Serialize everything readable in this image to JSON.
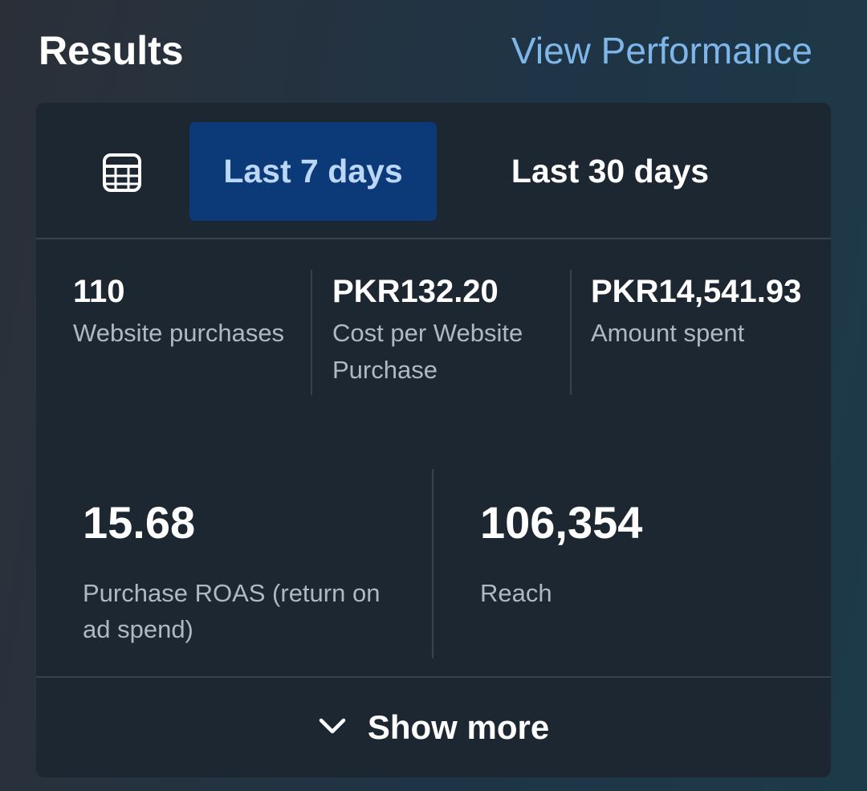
{
  "header": {
    "title": "Results",
    "link_label": "View Performance"
  },
  "tabs": {
    "calendar_icon": "calendar-table-icon",
    "active_label": "Last 7 days",
    "inactive_label": "Last 30 days"
  },
  "metrics_top": [
    {
      "value": "110",
      "label": "Website purchases"
    },
    {
      "value": "PKR132.20",
      "label": "Cost per Website Purchase"
    },
    {
      "value": "PKR14,541.93",
      "label": "Amount spent"
    }
  ],
  "metrics_bottom": [
    {
      "value": "15.68",
      "label": "Purchase ROAS (return on ad spend)"
    },
    {
      "value": "106,354",
      "label": "Reach"
    }
  ],
  "footer": {
    "icon": "chevron-down-icon",
    "label": "Show more"
  },
  "colors": {
    "accent_link": "#7fb6ea",
    "active_tab_bg": "#0c3a78",
    "active_tab_text": "#bcd7f6",
    "card_bg": "#1c2731"
  }
}
